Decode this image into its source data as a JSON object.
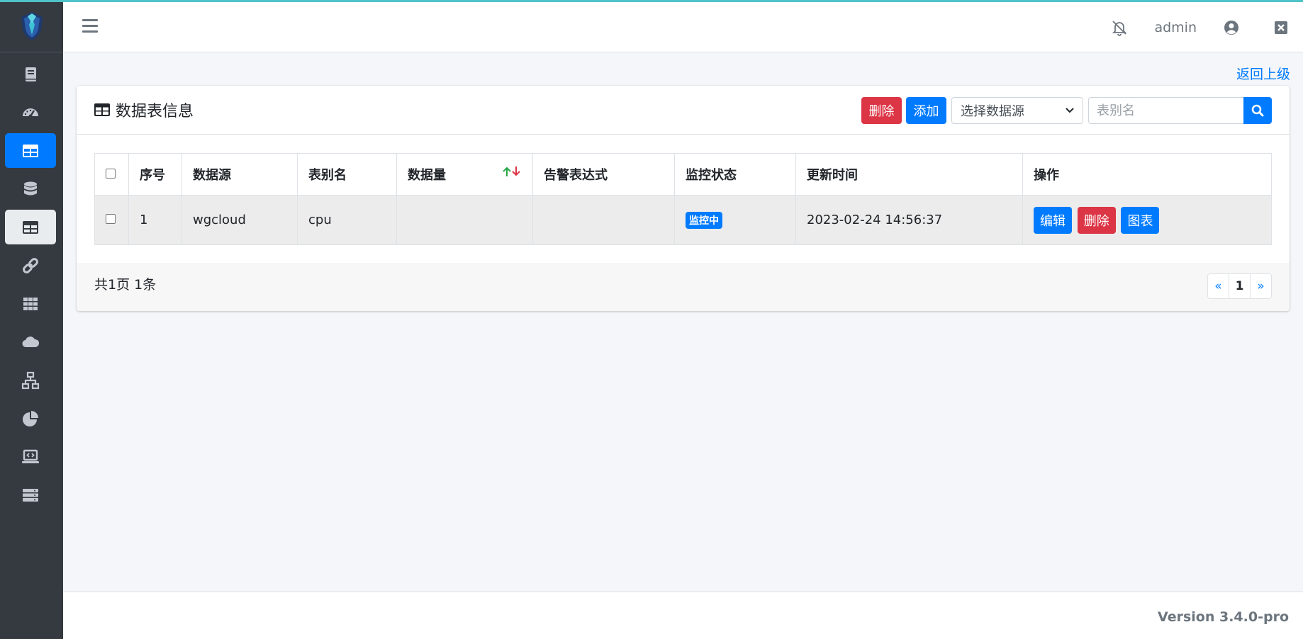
{
  "colors": {
    "sidebar_bg": "#343a40",
    "primary": "#007bff",
    "danger": "#dc3545",
    "accent_line": "#4fc3c7"
  },
  "sidebar": {
    "logo_icon": "shield-logo-icon",
    "items": [
      {
        "icon": "book-icon",
        "active": false
      },
      {
        "icon": "speedometer-icon",
        "active": false
      },
      {
        "icon": "table-icon",
        "active": true
      },
      {
        "icon": "database-icon",
        "active": false
      },
      {
        "icon": "table-icon",
        "active": false,
        "hover": true
      },
      {
        "icon": "link-icon",
        "active": false
      },
      {
        "icon": "grid-icon",
        "active": false
      },
      {
        "icon": "cloud-icon",
        "active": false
      },
      {
        "icon": "network-icon",
        "active": false
      },
      {
        "icon": "pie-chart-icon",
        "active": false
      },
      {
        "icon": "laptop-code-icon",
        "active": false
      },
      {
        "icon": "server-icon",
        "active": false
      }
    ]
  },
  "header": {
    "user": "admin",
    "icons": [
      "bell-slash-icon",
      "user-circle-icon",
      "close-window-icon"
    ]
  },
  "back_link": "返回上级",
  "card": {
    "title": "数据表信息",
    "delete_label": "删除",
    "add_label": "添加",
    "datasource_select": "选择数据源",
    "search_placeholder": "表别名"
  },
  "table": {
    "headers": [
      "序号",
      "数据源",
      "表别名",
      "数据量",
      "告警表达式",
      "监控状态",
      "更新时间",
      "操作"
    ],
    "rows": [
      {
        "index": "1",
        "datasource": "wgcloud",
        "alias": "cpu",
        "count": "",
        "alert_expr": "",
        "status": "监控中",
        "updated": "2023-02-24 14:56:37",
        "actions": [
          "编辑",
          "删除",
          "图表"
        ]
      }
    ]
  },
  "pagination": {
    "info": "共1页 1条",
    "prev": "«",
    "current": "1",
    "next": "»"
  },
  "footer": {
    "version": "Version 3.4.0-pro"
  }
}
